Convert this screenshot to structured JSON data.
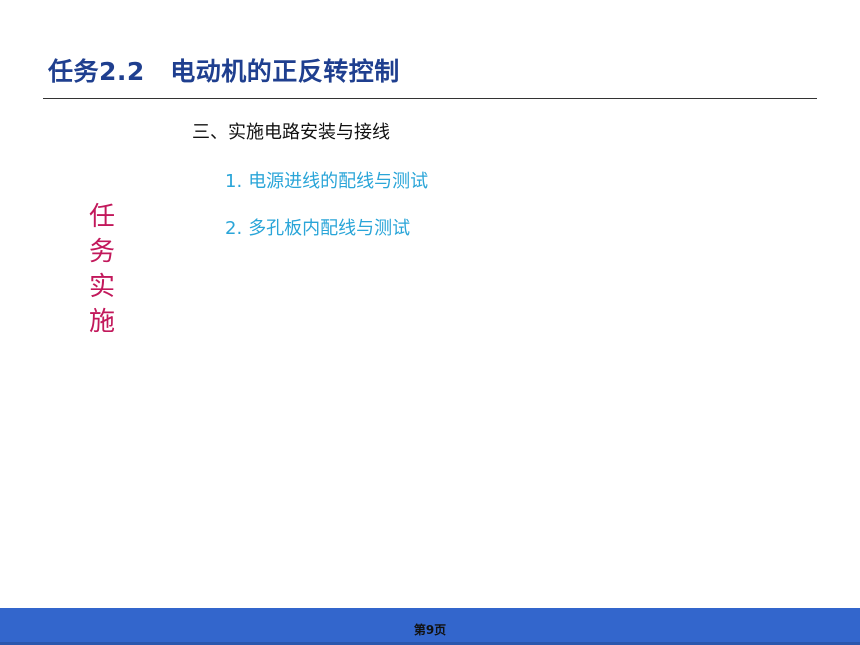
{
  "slide": {
    "title": "任务2.2　电动机的正反转控制",
    "side_label": [
      "任",
      "务",
      "实",
      "施"
    ],
    "section_heading": "三、实施电路安装与接线",
    "items": [
      {
        "num": "1.",
        "text": "电源进线的配线与测试"
      },
      {
        "num": "2.",
        "text": "多孔板内配线与测试"
      }
    ]
  },
  "footer": {
    "page_label": "第9页"
  },
  "colors": {
    "title": "#1f3f8f",
    "side_label": "#c2185b",
    "items": "#2aa5d8",
    "footer_bar": "#3366cc"
  }
}
